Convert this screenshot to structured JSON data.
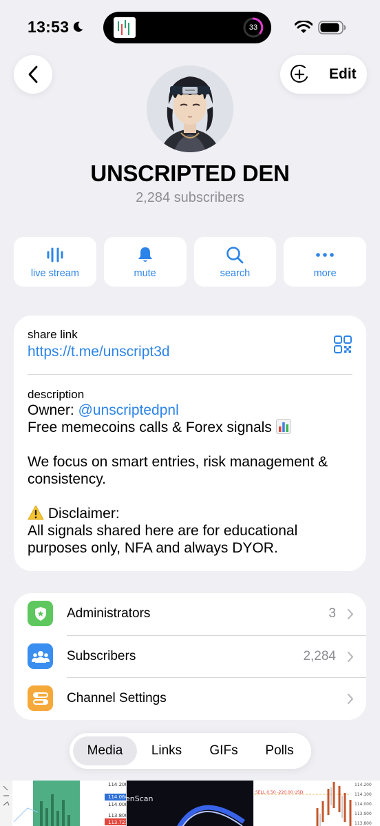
{
  "status_bar": {
    "time": "13:53",
    "live_activity_count": "33"
  },
  "header": {
    "edit_label": "Edit"
  },
  "channel": {
    "title": "UNSCRIPTED DEN",
    "subscribers_text": "2,284 subscribers"
  },
  "actions": [
    {
      "label": "live stream",
      "icon": "live-stream-icon"
    },
    {
      "label": "mute",
      "icon": "bell-icon"
    },
    {
      "label": "search",
      "icon": "search-icon"
    },
    {
      "label": "more",
      "icon": "more-dots-icon"
    }
  ],
  "info": {
    "share_link_label": "share link",
    "share_link": "https://t.me/unscript3d",
    "description_label": "description",
    "owner_prefix": "Owner: ",
    "owner_handle": "@unscriptedpnl",
    "line_calls": "Free memecoins calls & Forex signals",
    "line_focus": "We focus on smart entries, risk management & consistency.",
    "disclaimer_title": "Disclaimer:",
    "disclaimer_text": "All signals shared here are for educational purposes only, NFA and always DYOR."
  },
  "settings": {
    "rows": [
      {
        "label": "Administrators",
        "value": "3",
        "icon": "shield-star-icon",
        "color": "#5ec75e"
      },
      {
        "label": "Subscribers",
        "value": "2,284",
        "icon": "people-icon",
        "color": "#3a8ef0"
      },
      {
        "label": "Channel Settings",
        "value": "",
        "icon": "sliders-icon",
        "color": "#f5a93a"
      }
    ]
  },
  "media_tabs": {
    "items": [
      "Media",
      "Links",
      "GIFs",
      "Polls"
    ],
    "active": "Media"
  },
  "media_strip": {
    "thumb1_prices": [
      "114.200",
      "114.064",
      "114.000",
      "113.800",
      "113.723"
    ],
    "thumb2_text": "enScan",
    "thumb3_order": "SELL 0.50 -220.00 USD",
    "thumb3_prices": [
      "114.200",
      "114.100",
      "114.000",
      "113.900",
      "113.800"
    ]
  },
  "colors": {
    "accent": "#2c84e8",
    "background": "#efeff4",
    "secondary_text": "#8e8e93"
  }
}
